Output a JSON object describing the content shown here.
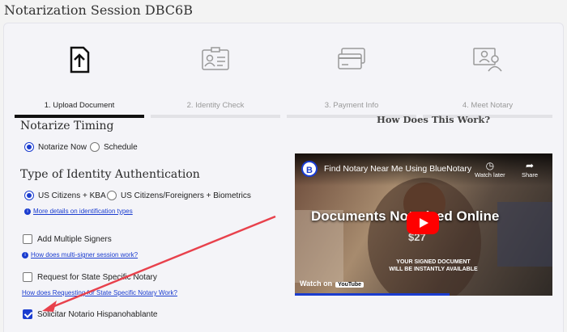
{
  "page": {
    "title": "Notarization Session DBC6B"
  },
  "steps": [
    {
      "label": "1. Upload Document",
      "icon": "upload-document-icon",
      "active": true
    },
    {
      "label": "2. Identity Check",
      "icon": "id-card-icon",
      "active": false
    },
    {
      "label": "3. Payment Info",
      "icon": "credit-card-icon",
      "active": false
    },
    {
      "label": "4. Meet Notary",
      "icon": "notary-meeting-icon",
      "active": false
    }
  ],
  "timing": {
    "heading": "Notarize Timing",
    "options": [
      {
        "label": "Notarize Now",
        "checked": true
      },
      {
        "label": "Schedule",
        "checked": false
      }
    ]
  },
  "identity": {
    "heading": "Type of Identity Authentication",
    "options": [
      {
        "label": "US Citizens + KBA",
        "checked": true
      },
      {
        "label": "US Citizens/Foreigners + Biometrics",
        "checked": false
      }
    ],
    "more_link": "More details on identification types"
  },
  "signers": {
    "checkbox_label": "Add Multiple Signers",
    "checked": false,
    "link": "How does multi-signer session work?"
  },
  "state_notary": {
    "checkbox_label": "Request for State Specific Notary",
    "checked": false,
    "link": "How does Requesting for State Specific Notary Work?"
  },
  "spanish": {
    "checkbox_label": "Solicitar Notario Hispanohablante",
    "checked": true
  },
  "how_it_works": {
    "heading": "How Does This Work?",
    "video": {
      "channel_initial": "B",
      "title": "Find Notary Near Me Using BlueNotary",
      "watch_later": "Watch later",
      "share": "Share",
      "headline": "Documents Notarized Online",
      "price": "$27",
      "subtext": "YOUR SIGNED DOCUMENT WILL BE INSTANTLY AVAILABLE",
      "watch_on": "Watch on",
      "youtube": "YouTube"
    }
  },
  "colors": {
    "accent": "#1a3ccf",
    "arrow": "#e8414c",
    "active_step": "#111111"
  }
}
